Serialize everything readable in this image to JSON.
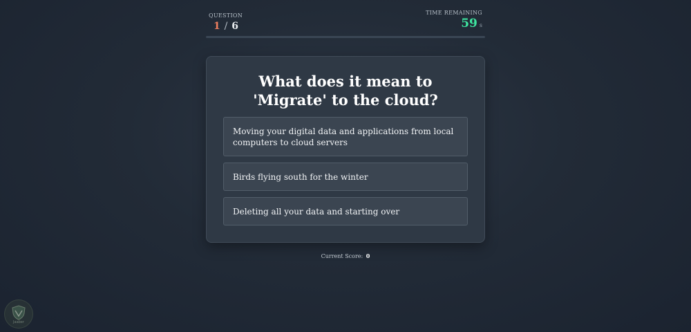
{
  "header": {
    "question_label": "QUESTION",
    "question_current": "1",
    "question_separator": "/",
    "question_total": "6",
    "time_label": "TIME REMAINING",
    "time_value": "59",
    "time_unit": "s",
    "progress_fraction": 0.0
  },
  "quiz": {
    "question": "What does it mean to 'Migrate' to the cloud?",
    "options": [
      "Moving your digital data and applications from local computers to cloud servers",
      "Birds flying south for the winter",
      "Deleting all your data and starting over"
    ]
  },
  "score": {
    "label": "Current Score:",
    "value": "0"
  },
  "badge": {
    "icon": "shield-leaf-icon",
    "text": "Jaaber"
  },
  "colors": {
    "accent_question": "#f07f5f",
    "accent_timer": "#3ee6a0",
    "card_bg": "#2f3945",
    "option_bg": "#3b4551"
  }
}
